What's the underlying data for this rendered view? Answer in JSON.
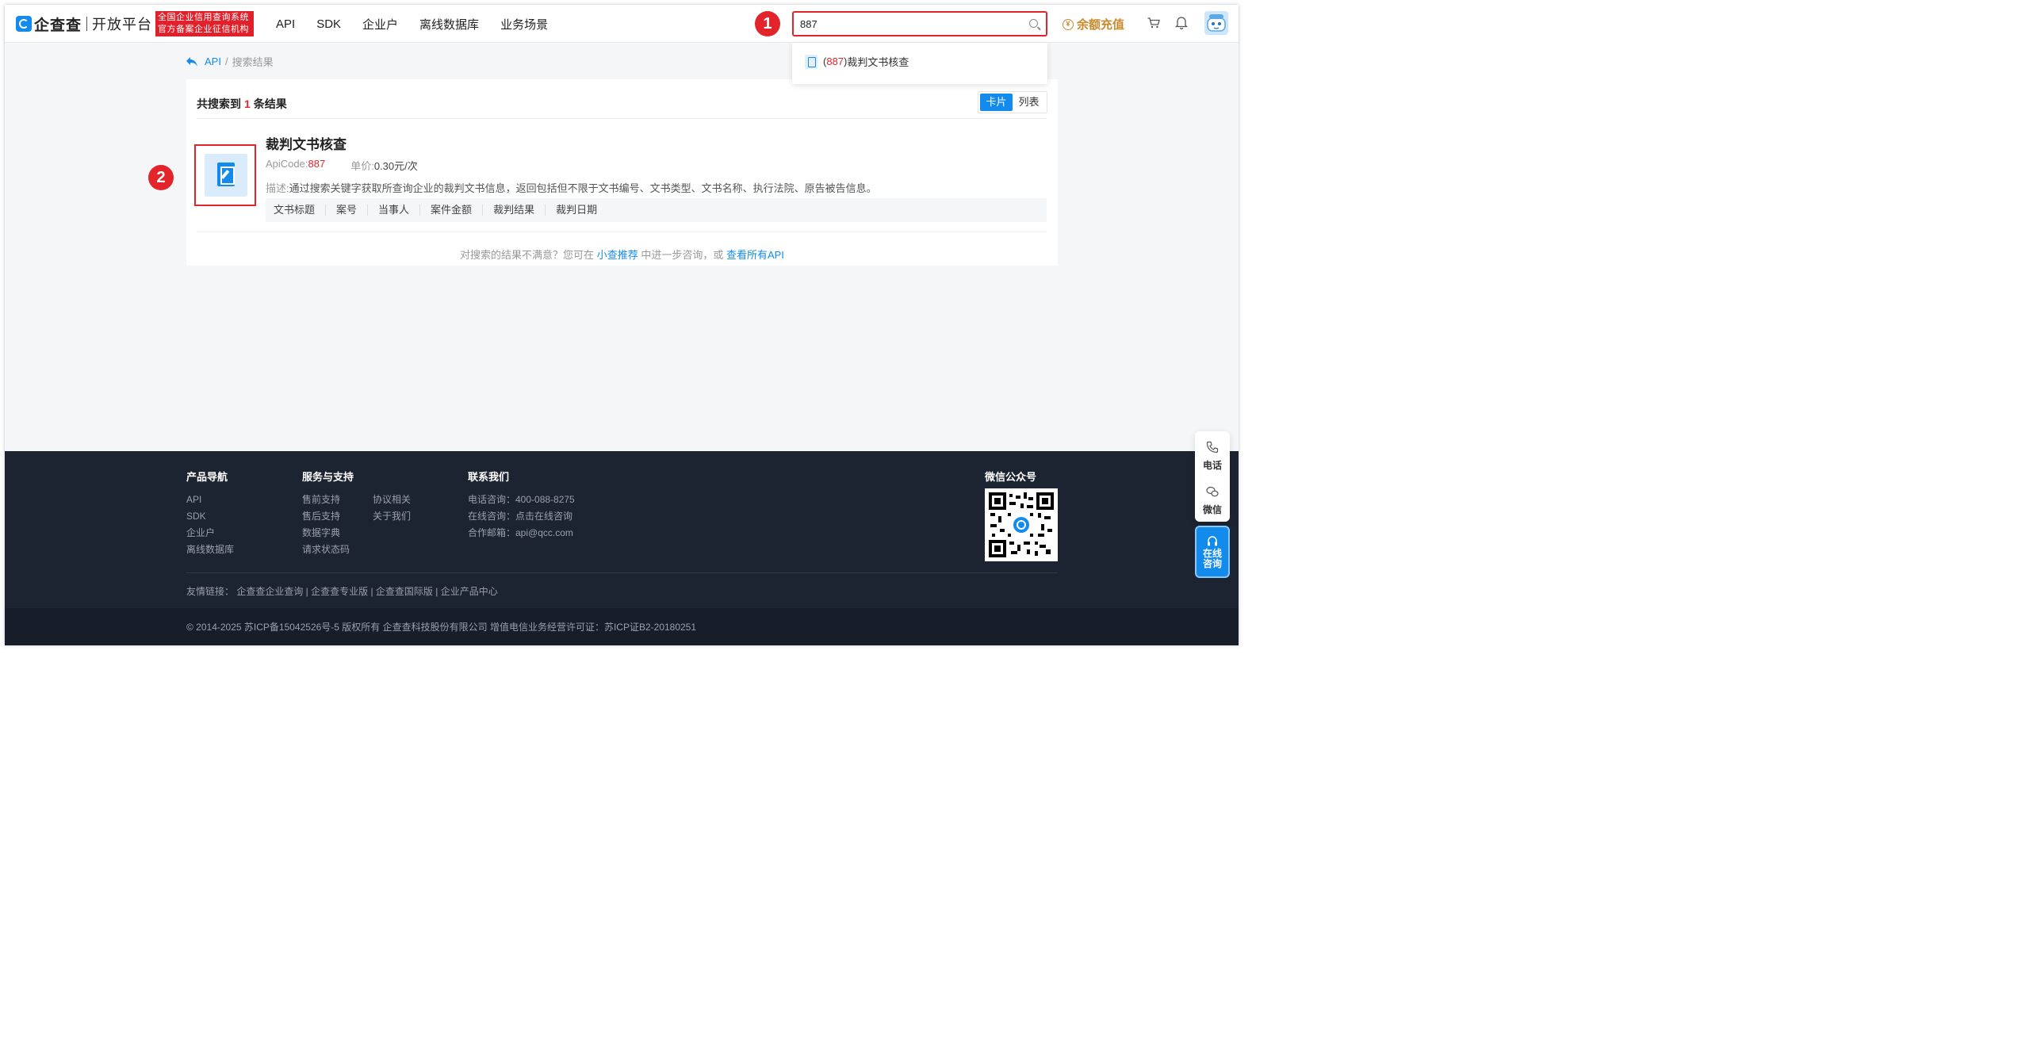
{
  "header": {
    "logo_text": "企查查",
    "logo_sub": "开放平台",
    "badge_line1": "全国企业信用查询系统",
    "badge_line2": "官方备案企业征信机构",
    "nav": [
      "API",
      "SDK",
      "企业户",
      "离线数据库",
      "业务场景"
    ],
    "search_value": "887",
    "recharge_label": "余额充值",
    "coin_symbol": "¥"
  },
  "markers": {
    "one": "1",
    "two": "2"
  },
  "dropdown": {
    "code": "887",
    "name": "裁判文书核查"
  },
  "breadcrumb": {
    "root": "API",
    "sep": "/",
    "current": "搜索结果"
  },
  "results": {
    "prefix": "共搜索到",
    "count": "1",
    "suffix": "条结果",
    "view_card": "卡片",
    "view_list": "列表"
  },
  "api": {
    "name": "裁判文书核查",
    "code_label": "ApiCode:",
    "code": "887",
    "price_label": "单价:",
    "price": "0.30元/次",
    "desc_label": "描述:",
    "desc": "通过搜索关键字获取所查询企业的裁判文书信息，返回包括但不限于文书编号、文书类型、文书名称、执行法院、原告被告信息。",
    "tags": [
      "文书标题",
      "案号",
      "当事人",
      "案件金额",
      "裁判结果",
      "裁判日期"
    ]
  },
  "not_satisfied": {
    "text1": "对搜索的结果不满意？您可在",
    "link1": "小查推荐",
    "text2": "中进一步咨询，或",
    "link2": "查看所有API"
  },
  "footer": {
    "product_title": "产品导航",
    "product_links": [
      "API",
      "SDK",
      "企业户",
      "离线数据库"
    ],
    "service_title": "服务与支持",
    "service_col1": [
      "售前支持",
      "售后支持",
      "数据字典",
      "请求状态码"
    ],
    "service_col2": [
      "协议相关",
      "关于我们"
    ],
    "contact_title": "联系我们",
    "contact_lines": [
      "电话咨询：400-088-8275",
      "在线咨询：点击在线咨询",
      "合作邮箱：api@qcc.com"
    ],
    "wechat_title": "微信公众号",
    "friend_links": "友情链接：  企查查企业查询 | 企查查专业版 | 企查查国际版 | 企业产品中心",
    "copyright": "© 2014-2025 苏ICP备15042526号-5 版权所有 企查查科技股份有限公司 增值电信业务经营许可证：苏ICP证B2-20180251"
  },
  "float": {
    "phone": "电话",
    "wechat": "微信",
    "online_1": "在线",
    "online_2": "咨询"
  },
  "colors": {
    "brand": "#128bed",
    "marker": "#e3242b",
    "recharge": "#c88a2c",
    "footer": "#1c2331"
  }
}
